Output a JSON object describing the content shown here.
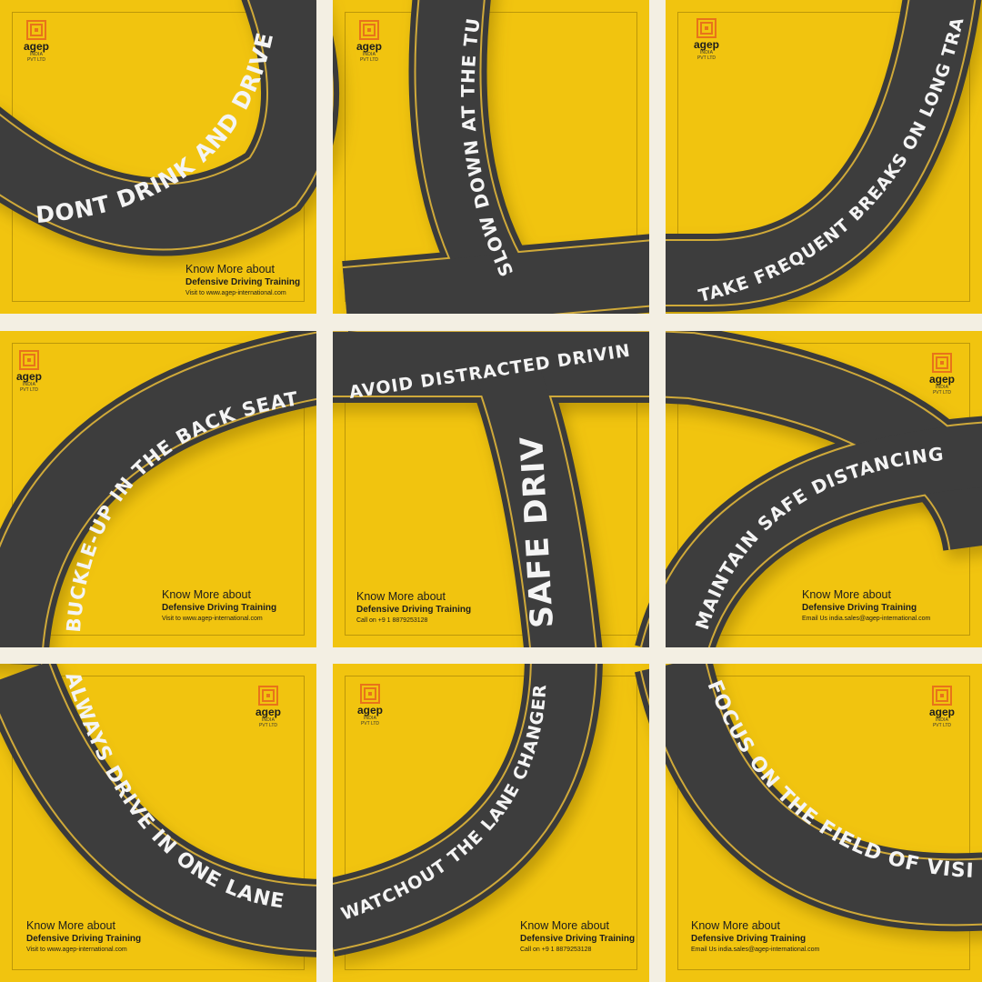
{
  "brand": {
    "name": "agep",
    "line1": "INDIA",
    "line2": "PVT LTD",
    "tm": "TM",
    "accent": "#e8731a"
  },
  "colors": {
    "background": "#f1c40f",
    "road": "#3a3a3a",
    "lane": "#e0b63a"
  },
  "slogans": {
    "s1": "DONT DRINK AND DRIVE",
    "s2": "SLOW DOWN AT THE TURN",
    "s3": "TAKE FREQUENT BREAKS ON LONG TRAVEL",
    "s4": "BUCKLE-UP IN THE BACK SEAT",
    "s5": "AVOID DISTRACTED DRIVING",
    "s6": "SAFE DRIVE",
    "s7": "MAINTAIN SAFE DISTANCING",
    "s8": "ALWAYS DRIVE IN ONE LANE",
    "s9": "WATCHOUT THE LANE CHANGERS",
    "s10": "FOCUS ON THE FIELD OF VISION"
  },
  "cta": {
    "heading": "Know More about",
    "course": "Defensive Driving Training"
  },
  "contacts": {
    "visit": "Visit to www.agep-international.com",
    "call": "Call on +9 1 8879253128",
    "email": "Email Us india.sales@agep-international.com"
  }
}
